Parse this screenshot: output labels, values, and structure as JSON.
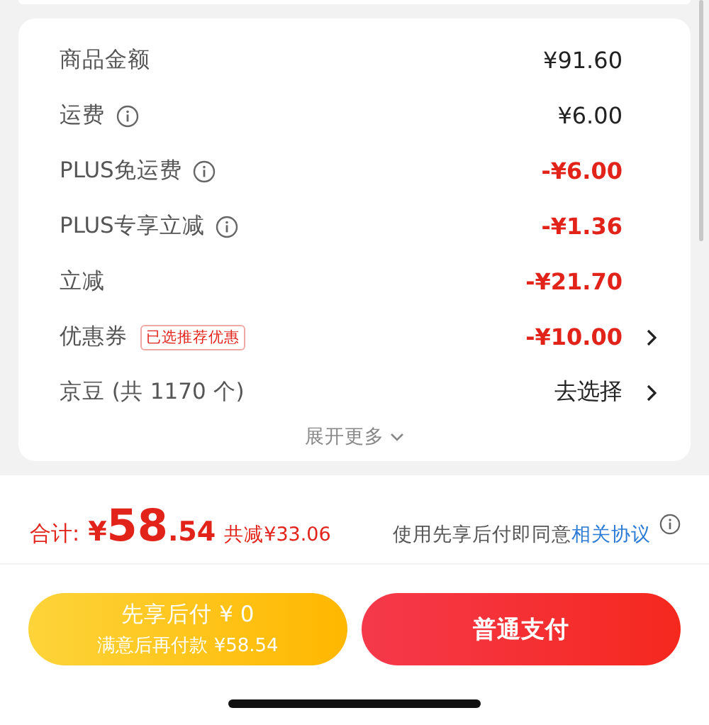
{
  "rows": [
    {
      "label": "商品金额",
      "info": false,
      "value": "¥91.60",
      "kind": "normal",
      "chevron": false
    },
    {
      "label": "运费",
      "info": true,
      "value": "¥6.00",
      "kind": "normal",
      "chevron": false
    },
    {
      "label": "PLUS免运费",
      "info": true,
      "value": "-¥6.00",
      "kind": "discount",
      "chevron": false
    },
    {
      "label": "PLUS专享立减",
      "info": true,
      "value": "-¥1.36",
      "kind": "discount",
      "chevron": false
    },
    {
      "label": "立减",
      "info": false,
      "value": "-¥21.70",
      "kind": "discount",
      "chevron": false
    },
    {
      "label": "优惠券",
      "info": false,
      "badge": "已选推荐优惠",
      "value": "-¥10.00",
      "kind": "discount",
      "chevron": true
    },
    {
      "label": "京豆 (共 1170 个)",
      "info": false,
      "value": "去选择",
      "kind": "normal",
      "chevron": true
    }
  ],
  "expand": "展开更多",
  "total": {
    "label": "合计:",
    "currency": "¥",
    "integer": "58",
    "decimal": ".54",
    "saved": "共减¥33.06"
  },
  "agreement": {
    "text": "使用先享后付即同意",
    "link": "相关协议"
  },
  "buttons": [
    {
      "kind": "later",
      "title": "先享后付 ¥ 0",
      "subtitle": "满意后再付款 ¥58.54"
    },
    {
      "kind": "pay",
      "title": "普通支付"
    }
  ]
}
